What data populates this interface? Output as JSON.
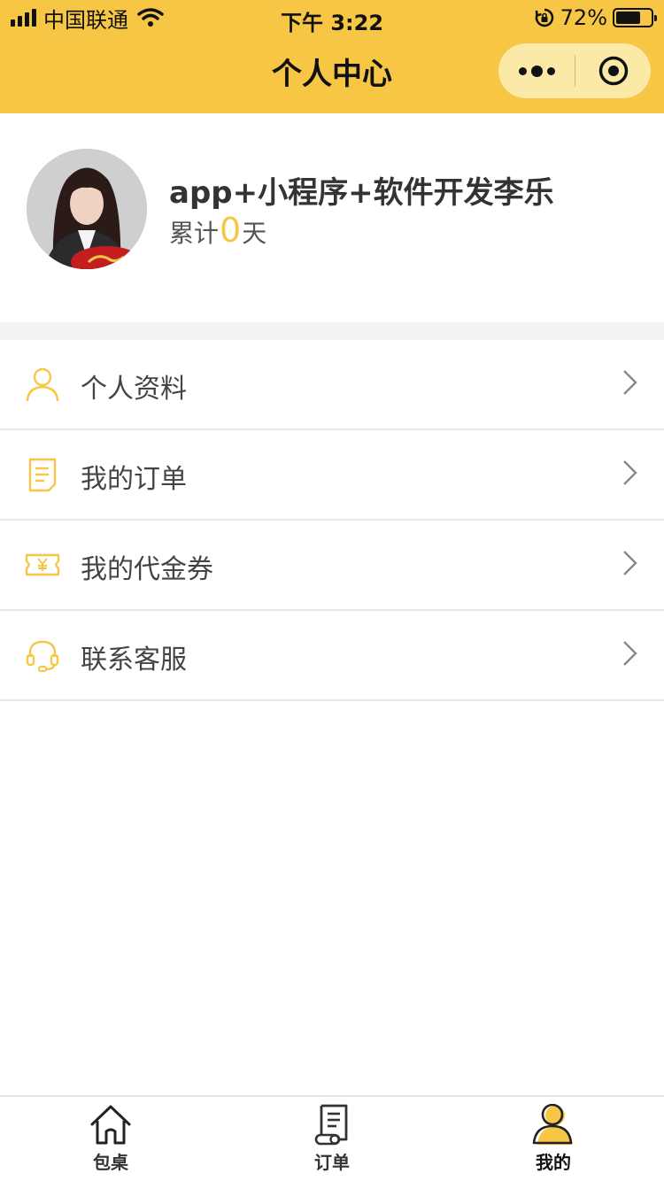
{
  "status_bar": {
    "carrier": "中国联通",
    "time": "下午 3:22",
    "battery_percent": "72%",
    "battery_level": 0.72
  },
  "nav": {
    "title": "个人中心"
  },
  "profile": {
    "name": "app+小程序+软件开发李乐",
    "stat_prefix": "累计",
    "stat_value": "0",
    "stat_suffix": "天"
  },
  "menu": {
    "items": [
      {
        "label": "个人资料",
        "icon": "user-icon"
      },
      {
        "label": "我的订单",
        "icon": "document-icon"
      },
      {
        "label": "我的代金券",
        "icon": "coupon-icon"
      },
      {
        "label": "联系客服",
        "icon": "headset-icon"
      }
    ]
  },
  "tabbar": {
    "items": [
      {
        "label": "包桌",
        "icon": "home-icon"
      },
      {
        "label": "订单",
        "icon": "order-icon"
      },
      {
        "label": "我的",
        "icon": "user-filled-icon",
        "active": true
      }
    ]
  },
  "colors": {
    "accent": "#f6c644",
    "capsule": "#fbe9a8",
    "divider": "#e8e8e8",
    "section_gap": "#f3f3f3"
  }
}
